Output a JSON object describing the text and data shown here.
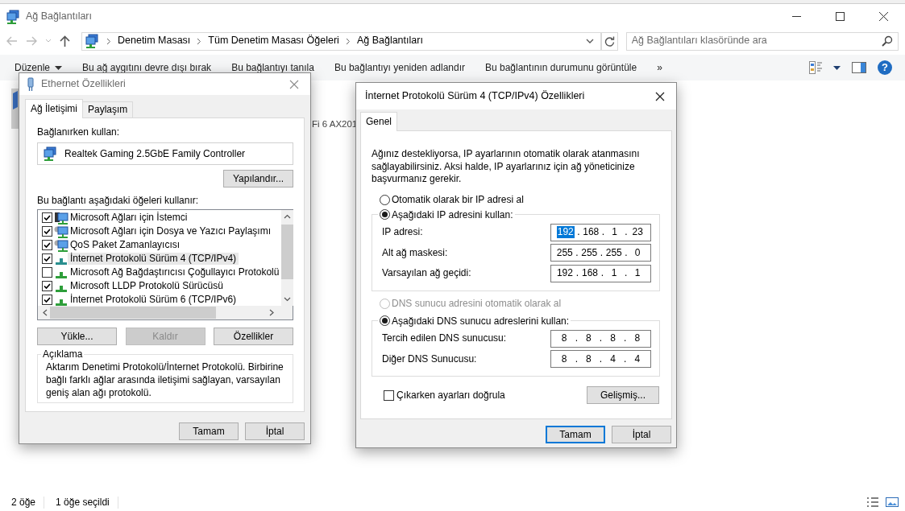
{
  "window": {
    "title": "Ağ Bağlantıları"
  },
  "address_bar": {
    "breadcrumbs": [
      "Denetim Masası",
      "Tüm Denetim Masası Öğeleri",
      "Ağ Bağlantıları"
    ]
  },
  "search": {
    "placeholder": "Ağ Bağlantıları klasöründe ara"
  },
  "toolbar": {
    "items": [
      {
        "label": "Düzenle",
        "dropdown": true
      },
      {
        "label": "Bu ağ aygıtını devre dışı bırak",
        "dropdown": false
      },
      {
        "label": "Bu bağlantıyı tanıla",
        "dropdown": false
      },
      {
        "label": "Bu bağlantıyı yeniden adlandır",
        "dropdown": false
      },
      {
        "label": "Bu bağlantının durumunu görüntüle",
        "dropdown": false
      }
    ],
    "more": "»",
    "help": "?"
  },
  "content": {
    "partial_label": "Fi 6 AX201"
  },
  "ethernet_dialog": {
    "title": "Ethernet Özellikleri",
    "tabs": [
      {
        "label": "Ağ İletişimi",
        "selected": true
      },
      {
        "label": "Paylaşım",
        "selected": false
      }
    ],
    "connect_using_label": "Bağlanırken kullan:",
    "adapter": "Realtek Gaming 2.5GbE Family Controller",
    "configure_button": "Yapılandır...",
    "components_label": "Bu bağlantı aşağıdaki öğeleri kullanır:",
    "components": [
      {
        "label": "Microsoft Ağları için İstemci",
        "kind": "client",
        "checked": true,
        "selected": false
      },
      {
        "label": "Microsoft Ağları için Dosya ve Yazıcı Paylaşımı",
        "kind": "service",
        "checked": true,
        "selected": false
      },
      {
        "label": "QoS Paket Zamanlayıcısı",
        "kind": "service",
        "checked": true,
        "selected": false
      },
      {
        "label": "İnternet Protokolü Sürüm 4 (TCP/IPv4)",
        "kind": "protocol",
        "checked": true,
        "selected": true
      },
      {
        "label": "Microsoft Ağ Bağdaştırıcısı Çoğullayıcı Protokolü",
        "kind": "protocol",
        "checked": false,
        "selected": false
      },
      {
        "label": "Microsoft LLDP Protokolü Sürücüsü",
        "kind": "protocol",
        "checked": true,
        "selected": false
      },
      {
        "label": "İnternet Protokolü Sürüm 6 (TCP/IPv6)",
        "kind": "protocol",
        "checked": true,
        "selected": false
      }
    ],
    "buttons": [
      {
        "label": "Yükle...",
        "disabled": false
      },
      {
        "label": "Kaldır",
        "disabled": true
      },
      {
        "label": "Özellikler",
        "disabled": false
      }
    ],
    "description_title": "Açıklama",
    "description": "Aktarım Denetimi Protokolü/İnternet Protokolü. Birbirine bağlı farklı ağlar arasında iletişimi sağlayan, varsayılan geniş alan ağı protokolü.",
    "footer_buttons": [
      {
        "label": "Tamam",
        "default": false
      },
      {
        "label": "İptal",
        "default": false
      }
    ]
  },
  "ipv4_dialog": {
    "title": "İnternet Protokolü Sürüm 4 (TCP/IPv4) Özellikleri",
    "tabs": [
      {
        "label": "Genel",
        "selected": true
      }
    ],
    "intro": "Ağınız destekliyorsa, IP ayarlarının otomatik olarak atanmasını sağlayabilirsiniz. Aksi halde, IP ayarlarınız için ağ yöneticinize başvurmanız gerekir.",
    "separator": ".",
    "ip_options": [
      {
        "label": "Otomatik olarak bir IP adresi al",
        "selected": false,
        "disabled": false
      },
      {
        "label": "Aşağıdaki IP adresini kullan:",
        "selected": true,
        "disabled": false
      }
    ],
    "ip_fields": [
      {
        "label": "IP adresi:",
        "octets": [
          "192",
          "168",
          "1",
          "23"
        ],
        "highlight_first": true
      },
      {
        "label": "Alt ağ maskesi:",
        "octets": [
          "255",
          "255",
          "255",
          "0"
        ],
        "highlight_first": false
      },
      {
        "label": "Varsayılan ağ geçidi:",
        "octets": [
          "192",
          "168",
          "1",
          "1"
        ],
        "highlight_first": false
      }
    ],
    "dns_options": [
      {
        "label": "DNS sunucu adresini otomatik olarak al",
        "selected": false,
        "disabled": true
      },
      {
        "label": "Aşağıdaki DNS sunucu adreslerini kullan:",
        "selected": true,
        "disabled": false
      }
    ],
    "dns_fields": [
      {
        "label": "Tercih edilen DNS sunucusu:",
        "octets": [
          "8",
          "8",
          "8",
          "8"
        ],
        "highlight_first": false
      },
      {
        "label": "Diğer DNS Sunucusu:",
        "octets": [
          "8",
          "8",
          "4",
          "4"
        ],
        "highlight_first": false
      }
    ],
    "validate": {
      "label": "Çıkarken ayarları doğrula",
      "checked": false
    },
    "advanced_button": "Gelişmiş...",
    "footer_buttons": [
      {
        "label": "Tamam",
        "default": true
      },
      {
        "label": "İptal",
        "default": false
      }
    ]
  },
  "status_bar": {
    "items": [
      "2 öğe",
      "1 öğe seçildi"
    ]
  }
}
